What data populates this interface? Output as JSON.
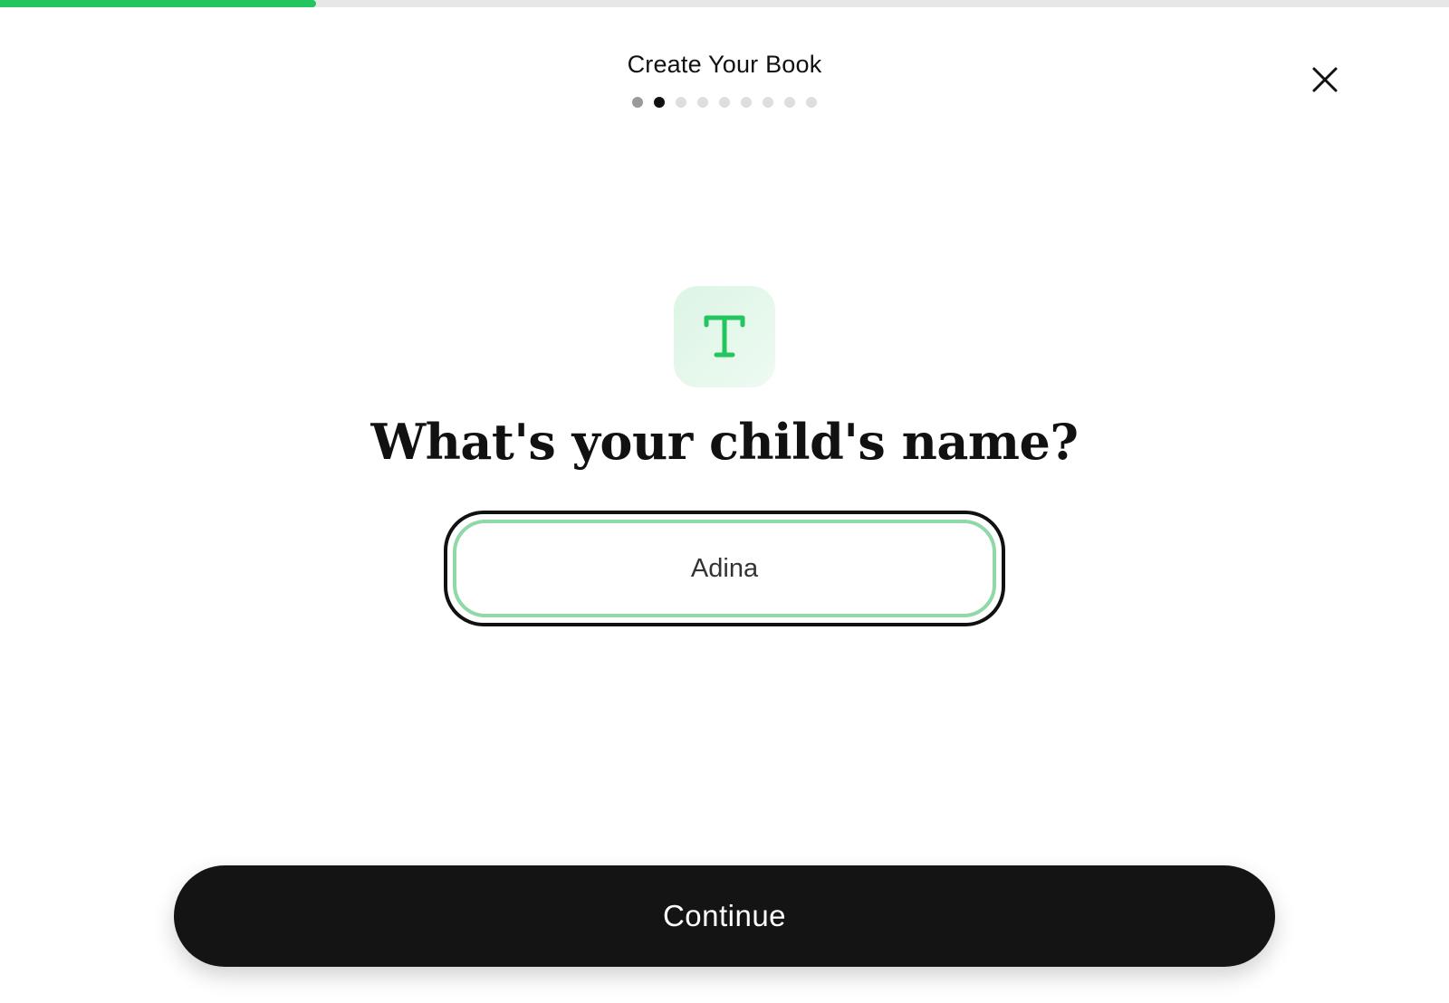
{
  "progress": {
    "fraction": 0.218,
    "color": "#22c55e"
  },
  "header": {
    "title": "Create Your Book",
    "steps": {
      "total": 9,
      "current": 2
    },
    "close_icon": "close-icon"
  },
  "step_icon": {
    "icon": "text-type-icon",
    "color": "#22c55e"
  },
  "question": {
    "text": "What's your child's name?"
  },
  "name_input": {
    "value": "Adina"
  },
  "footer": {
    "continue_label": "Continue"
  }
}
